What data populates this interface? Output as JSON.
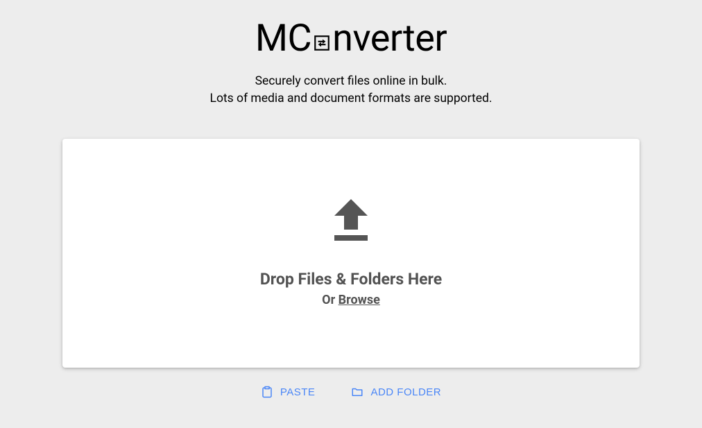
{
  "logo": {
    "prefix": "MC",
    "suffix": "nverter"
  },
  "tagline": {
    "line1": "Securely convert files online in bulk.",
    "line2": "Lots of media and document formats are supported."
  },
  "dropzone": {
    "title": "Drop Files & Folders Here",
    "or": "Or ",
    "browse": "Browse"
  },
  "actions": {
    "paste": "PASTE",
    "addFolder": "ADD FOLDER"
  }
}
